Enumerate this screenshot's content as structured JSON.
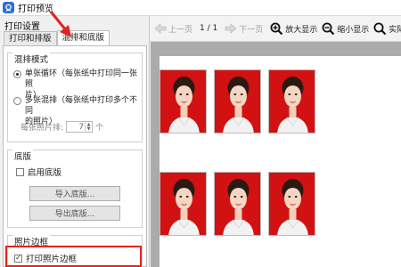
{
  "window": {
    "title": "打印预览",
    "icon": "print-preview-app-icon"
  },
  "left_panel": {
    "heading": "打印设置",
    "tabs": [
      {
        "label": "打印和排版",
        "active": false
      },
      {
        "label": "混排和底版",
        "active": true
      }
    ],
    "mix_mode": {
      "title": "混排模式",
      "options": [
        {
          "label_line1": "单张循环（每张纸中打印同一张照",
          "label_line2": "片）",
          "checked": true
        },
        {
          "label_line1": "多张混排（每张纸中打印多个不同",
          "label_line2": "的照片）",
          "checked": false
        }
      ],
      "count_label": "每张照片排:",
      "count_value": "7",
      "count_unit": "个"
    },
    "template": {
      "title": "底版",
      "enable_label": "启用底版",
      "enabled": false,
      "import_button": "导入底版...",
      "export_button": "导出底版..."
    },
    "border": {
      "title": "照片边框",
      "print_border_label": "打印照片边框",
      "checked": true
    }
  },
  "toolbar": {
    "prev_page": "上一页",
    "page_indicator": "1 / 1",
    "next_page": "下一页",
    "zoom_in": "放大显示",
    "zoom_out": "缩小显示",
    "actual_size": "实际尺"
  },
  "preview": {
    "photo_background_color": "#d21212",
    "photo_count_visible": 6
  },
  "colors": {
    "highlight": "#e0241f",
    "app_icon": "#2f6fd6"
  }
}
